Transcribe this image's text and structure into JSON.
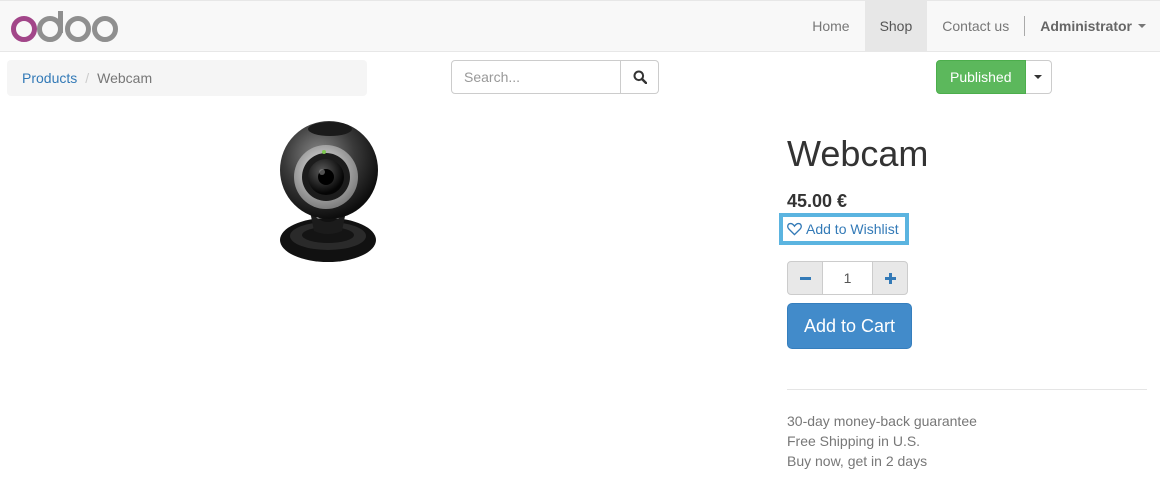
{
  "brand": {
    "name": "odoo",
    "colors": {
      "o": "#a24689",
      "doo": "#8f8f8f"
    }
  },
  "nav": {
    "items": [
      {
        "label": "Home",
        "active": false
      },
      {
        "label": "Shop",
        "active": true
      },
      {
        "label": "Contact us",
        "active": false
      }
    ],
    "user": "Administrator"
  },
  "breadcrumb": {
    "parent": "Products",
    "current": "Webcam"
  },
  "search": {
    "placeholder": "Search...",
    "value": ""
  },
  "publish": {
    "label": "Published",
    "color": "#5cb85c"
  },
  "product": {
    "name": "Webcam",
    "price": "45.00 €",
    "wishlist_label": "Add to Wishlist",
    "quantity": "1",
    "add_to_cart_label": "Add to Cart",
    "info_lines": [
      "30-day money-back guarantee",
      "Free Shipping in U.S.",
      "Buy now, get in 2 days"
    ]
  },
  "icons": {
    "search": "search-icon",
    "wishlist": "heart-icon",
    "minus": "minus-icon",
    "plus": "plus-icon"
  }
}
